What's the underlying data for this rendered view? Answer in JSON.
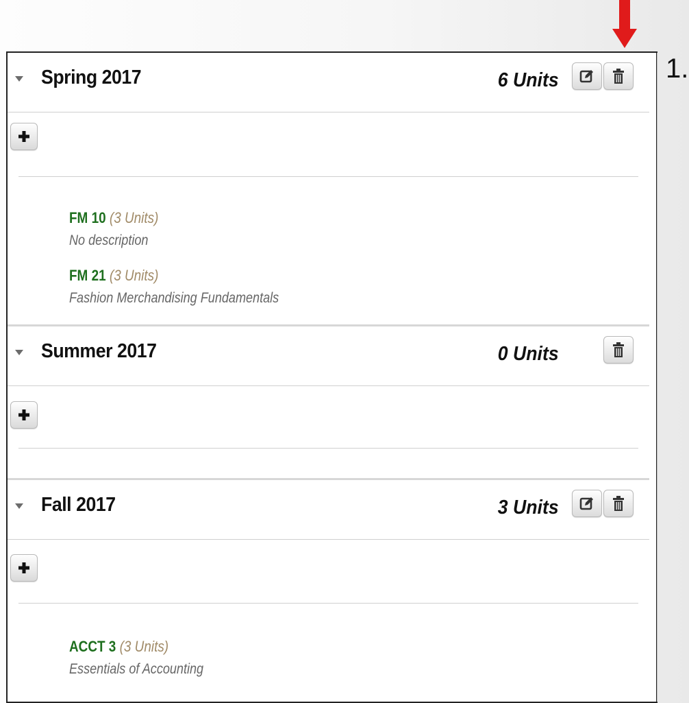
{
  "annotation": {
    "step_number": "1.",
    "accent_color": "#e01b1b"
  },
  "terms": [
    {
      "name": "Spring 2017",
      "units": "6 Units",
      "has_edit": true,
      "courses": [
        {
          "code": "FM 10",
          "units": "(3 Units)",
          "description": "No description"
        },
        {
          "code": "FM 21",
          "units": "(3 Units)",
          "description": "Fashion Merchandising Fundamentals"
        }
      ]
    },
    {
      "name": "Summer 2017",
      "units": "0 Units",
      "has_edit": false,
      "courses": []
    },
    {
      "name": "Fall 2017",
      "units": "3 Units",
      "has_edit": true,
      "courses": [
        {
          "code": "ACCT 3",
          "units": "(3 Units)",
          "description": "Essentials of Accounting"
        }
      ]
    }
  ],
  "icons": {
    "expand": "caret-down-icon",
    "edit": "edit-icon",
    "delete": "trash-icon",
    "add": "plus-icon"
  }
}
